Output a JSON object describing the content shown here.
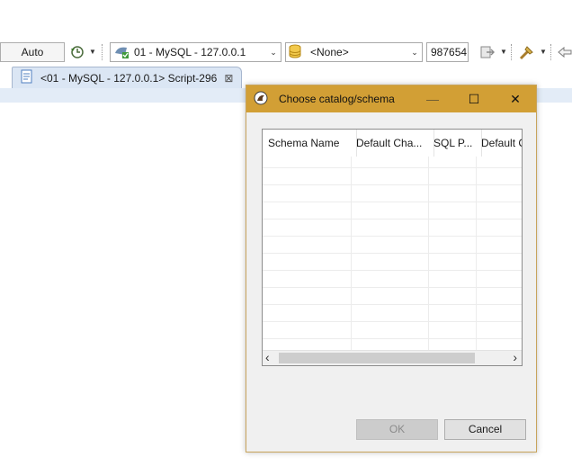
{
  "toolbar": {
    "commit_mode_label": "Auto",
    "datasource_value": "01 - MySQL - 127.0.0.1",
    "schema_value": "<None>",
    "limit_value": "987654:"
  },
  "editor": {
    "tab_label": "<01 - MySQL - 127.0.0.1> Script-296",
    "tab_close_glyph": "⊠"
  },
  "dialog": {
    "title": "Choose catalog/schema",
    "minimize_glyph": "—",
    "maximize_glyph": "☐",
    "close_glyph": "✕",
    "columns": [
      "Schema Name",
      "Default Cha...",
      "SQL P...",
      "Default C"
    ],
    "scroll_left_glyph": "‹",
    "scroll_right_glyph": "›",
    "ok_label": "OK",
    "cancel_label": "Cancel"
  },
  "colors": {
    "titlebar": "#d29f35",
    "dialog_bg": "#f0f0f0",
    "tab_bg": "#dbe6f4"
  },
  "icons": [
    "transaction-history-icon",
    "datasource-icon",
    "database-icon",
    "execute-icon",
    "format-icon",
    "tools-icon"
  ]
}
